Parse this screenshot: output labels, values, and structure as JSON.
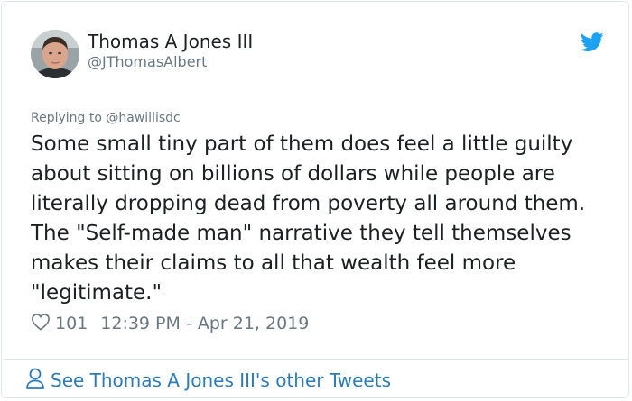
{
  "tweet": {
    "author_name": "Thomas A Jones III",
    "author_handle": "@JThomasAlbert",
    "reply_prefix": "Replying to ",
    "reply_to": "@hawillisdc",
    "text": "Some small tiny part of them does feel a little guilty about sitting on billions of dollars while people are literally dropping dead from poverty all around them. The \"Self-made man\" narrative they tell themselves makes their claims to all that wealth feel more \"legitimate.\"",
    "likes": "101",
    "timestamp": "12:39 PM - Apr 21, 2019"
  },
  "footer": {
    "link_label": "See Thomas A Jones III's other Tweets"
  },
  "colors": {
    "text": "#1c2022",
    "muted": "#697882",
    "link": "#2b7bb9",
    "twitter_blue": "#1da1f2",
    "border": "#e1e8ed"
  },
  "icons": [
    "avatar",
    "twitter-bird-icon",
    "heart-icon",
    "person-icon"
  ]
}
